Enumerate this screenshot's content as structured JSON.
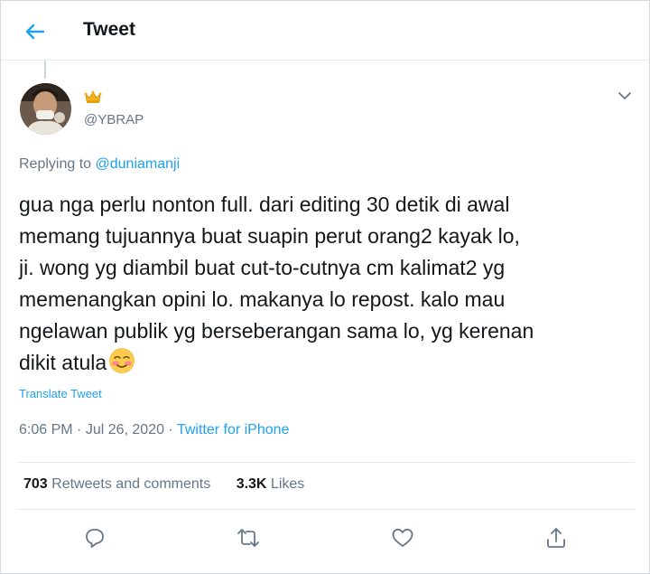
{
  "header": {
    "title": "Tweet",
    "back_icon": "arrow-left-icon"
  },
  "author": {
    "handle": "@YBRAP",
    "badge_icon": "crown-icon"
  },
  "reply": {
    "prefix": "Replying to ",
    "mention": "@duniamanji"
  },
  "tweet": {
    "text_lines": [
      "gua nga perlu nonton full. dari editing 30 detik di awal",
      "memang tujuannya buat suapin perut orang2 kayak lo,",
      "ji. wong yg diambil buat cut-to-cutnya cm kalimat2 yg",
      "memenangkan opini lo. makanya lo repost. kalo mau",
      "ngelawan publik yg berseberangan sama lo, yg kerenan",
      "dikit atula"
    ],
    "emoji": "smiling-face-with-blush",
    "translate": "Translate Tweet"
  },
  "meta": {
    "time": "6:06 PM",
    "sep": " · ",
    "date": "Jul 26, 2020",
    "source": "Twitter for iPhone"
  },
  "stats": {
    "retweets_count": "703",
    "retweets_label": " Retweets and comments",
    "likes_count": "3.3K",
    "likes_label": " Likes"
  },
  "actions": [
    "reply-icon",
    "retweet-icon",
    "like-icon",
    "share-icon"
  ],
  "colors": {
    "accent": "#1da1f2",
    "secondary_text": "#657786",
    "text": "#14171a",
    "divider": "#e6ecf0"
  }
}
